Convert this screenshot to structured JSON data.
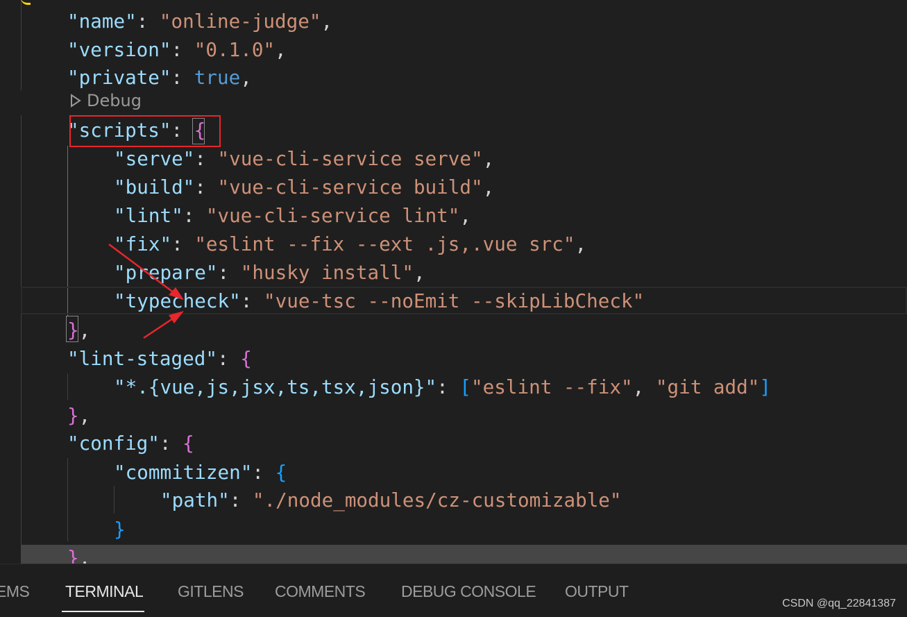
{
  "colors": {
    "key": "#9cdcfe",
    "string": "#ce9178",
    "keyword": "#569cd6",
    "punct": "#d4d4d4",
    "bracket_gold": "#ffd700",
    "bracket_magenta": "#da70d6",
    "bracket_blue": "#179fff",
    "annotation_red": "#e8262c"
  },
  "codelens": {
    "icon": "play-outline-icon",
    "label": "Debug"
  },
  "lines": [
    {
      "indent": 1,
      "tokens": [
        [
          "k",
          "\"name\""
        ],
        [
          "p",
          ": "
        ],
        [
          "s",
          "\"online-judge\""
        ],
        [
          "p",
          ","
        ]
      ]
    },
    {
      "indent": 1,
      "tokens": [
        [
          "k",
          "\"version\""
        ],
        [
          "p",
          ": "
        ],
        [
          "s",
          "\"0.1.0\""
        ],
        [
          "p",
          ","
        ]
      ]
    },
    {
      "indent": 1,
      "tokens": [
        [
          "k",
          "\"private\""
        ],
        [
          "p",
          ": "
        ],
        [
          "w",
          "true"
        ],
        [
          "p",
          ","
        ]
      ]
    },
    {
      "indent": 1,
      "tokens": [
        [
          "k",
          "\"scripts\""
        ],
        [
          "p",
          ": "
        ],
        [
          "m",
          "{"
        ]
      ]
    },
    {
      "indent": 2,
      "tokens": [
        [
          "k",
          "\"serve\""
        ],
        [
          "p",
          ": "
        ],
        [
          "s",
          "\"vue-cli-service serve\""
        ],
        [
          "p",
          ","
        ]
      ]
    },
    {
      "indent": 2,
      "tokens": [
        [
          "k",
          "\"build\""
        ],
        [
          "p",
          ": "
        ],
        [
          "s",
          "\"vue-cli-service build\""
        ],
        [
          "p",
          ","
        ]
      ]
    },
    {
      "indent": 2,
      "tokens": [
        [
          "k",
          "\"lint\""
        ],
        [
          "p",
          ": "
        ],
        [
          "s",
          "\"vue-cli-service lint\""
        ],
        [
          "p",
          ","
        ]
      ]
    },
    {
      "indent": 2,
      "tokens": [
        [
          "k",
          "\"fix\""
        ],
        [
          "p",
          ": "
        ],
        [
          "s",
          "\"eslint --fix --ext .js,.vue src\""
        ],
        [
          "p",
          ","
        ]
      ]
    },
    {
      "indent": 2,
      "tokens": [
        [
          "k",
          "\"prepare\""
        ],
        [
          "p",
          ": "
        ],
        [
          "s",
          "\"husky install\""
        ],
        [
          "p",
          ","
        ]
      ]
    },
    {
      "indent": 2,
      "tokens": [
        [
          "k",
          "\"typecheck\""
        ],
        [
          "p",
          ": "
        ],
        [
          "s",
          "\"vue-tsc --noEmit --skipLibCheck\""
        ]
      ]
    },
    {
      "indent": 1,
      "tokens": [
        [
          "m",
          "}"
        ],
        [
          "p",
          ","
        ]
      ]
    },
    {
      "indent": 1,
      "tokens": [
        [
          "k",
          "\"lint-staged\""
        ],
        [
          "p",
          ": "
        ],
        [
          "m",
          "{"
        ]
      ]
    },
    {
      "indent": 2,
      "tokens": [
        [
          "k",
          "\"*.{vue,js,jsx,ts,tsx,json}\""
        ],
        [
          "p",
          ": "
        ],
        [
          "b",
          "["
        ],
        [
          "s",
          "\"eslint --fix\""
        ],
        [
          "p",
          ", "
        ],
        [
          "s",
          "\"git add\""
        ],
        [
          "b",
          "]"
        ]
      ]
    },
    {
      "indent": 1,
      "tokens": [
        [
          "m",
          "}"
        ],
        [
          "p",
          ","
        ]
      ]
    },
    {
      "indent": 1,
      "tokens": [
        [
          "k",
          "\"config\""
        ],
        [
          "p",
          ": "
        ],
        [
          "m",
          "{"
        ]
      ]
    },
    {
      "indent": 2,
      "tokens": [
        [
          "k",
          "\"commitizen\""
        ],
        [
          "p",
          ": "
        ],
        [
          "b",
          "{"
        ]
      ]
    },
    {
      "indent": 3,
      "tokens": [
        [
          "k",
          "\"path\""
        ],
        [
          "p",
          ": "
        ],
        [
          "s",
          "\"./node_modules/cz-customizable\""
        ]
      ]
    },
    {
      "indent": 2,
      "tokens": [
        [
          "b",
          "}"
        ]
      ]
    },
    {
      "indent": 1,
      "tokens": [
        [
          "m",
          "}"
        ],
        [
          "p",
          ","
        ]
      ]
    }
  ],
  "panel": {
    "tabs": [
      {
        "label": "EMS",
        "active": false
      },
      {
        "label": "TERMINAL",
        "active": true
      },
      {
        "label": "GITLENS",
        "active": false
      },
      {
        "label": "COMMENTS",
        "active": false
      },
      {
        "label": "DEBUG CONSOLE",
        "active": false
      },
      {
        "label": "OUTPUT",
        "active": false
      }
    ]
  },
  "watermark": "CSDN @qq_22841387"
}
